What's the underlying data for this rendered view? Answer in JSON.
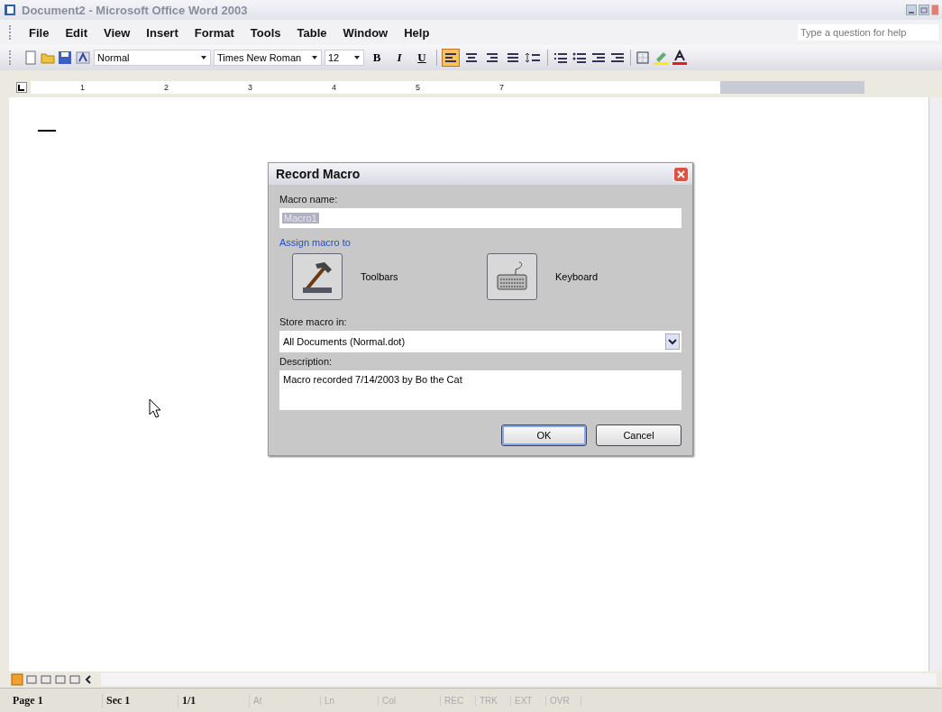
{
  "window": {
    "title": "Document2 - Microsoft Office Word 2003"
  },
  "menu": [
    "File",
    "Edit",
    "View",
    "Insert",
    "Format",
    "Tools",
    "Table",
    "Window",
    "Help"
  ],
  "help_box": {
    "placeholder": "Type a question for help"
  },
  "toolbar": {
    "style": "Normal",
    "font": "Times New Roman",
    "size": "12",
    "format_buttons": [
      {
        "label": "B",
        "kind": "bold"
      },
      {
        "label": "I",
        "kind": "italic"
      },
      {
        "label": "U",
        "kind": "underline"
      }
    ],
    "alignment": [
      {
        "selected": true
      },
      {
        "selected": false
      },
      {
        "selected": false
      },
      {
        "selected": false
      }
    ]
  },
  "ruler": [
    "1",
    "2",
    "3",
    "4",
    "5",
    "7"
  ],
  "dialog": {
    "title": "Record Macro",
    "macro_name_label": "Macro name:",
    "macro_name": "Macro1",
    "assign_label": "Assign macro to",
    "assign_buttons": [
      {
        "label": "Toolbars",
        "kind": "toolbars"
      },
      {
        "label": "Keyboard",
        "kind": "keyboard"
      }
    ],
    "store_label": "Store macro in:",
    "store_value": "All Documents (Normal.dot)",
    "description_label": "Description:",
    "description": "Macro recorded 7/14/2003 by Bo the Cat",
    "buttons": [
      {
        "label": "OK",
        "selected": true
      },
      {
        "label": "Cancel",
        "selected": false
      }
    ]
  },
  "status_bar": [
    {
      "text": "Page 1",
      "disabled": false
    },
    {
      "text": "Sec 1",
      "disabled": false
    },
    {
      "text": "1/1",
      "disabled": false
    },
    {
      "text": "At",
      "disabled": true
    },
    {
      "text": "Ln",
      "disabled": true
    },
    {
      "text": "Col",
      "disabled": true
    },
    {
      "text": "REC",
      "disabled": true
    },
    {
      "text": "TRK",
      "disabled": true
    },
    {
      "text": "EXT",
      "disabled": true
    },
    {
      "text": "OVR",
      "disabled": true
    }
  ]
}
